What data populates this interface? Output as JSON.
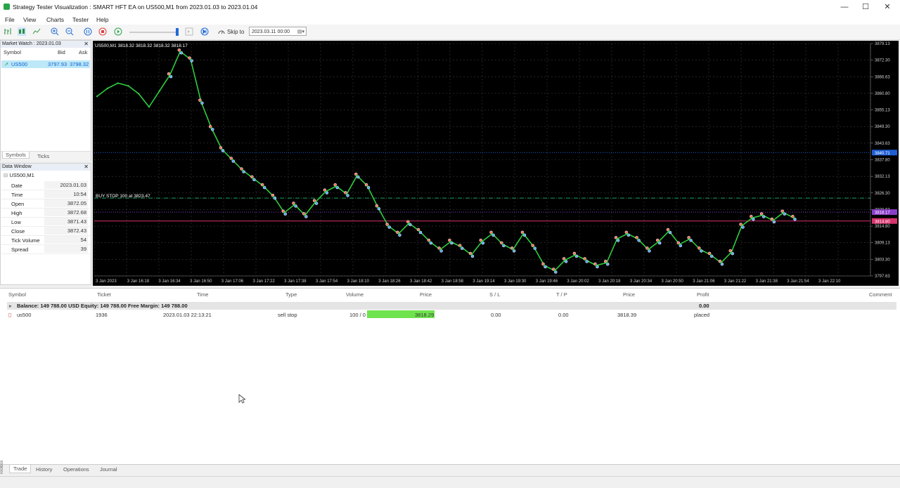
{
  "window": {
    "title": "Strategy Tester Visualization : SMART HFT EA  on US500,M1 from 2023.01.03 to 2023.01.04",
    "minimize": "—",
    "maximize": "☐",
    "close": "✕"
  },
  "menu": [
    "File",
    "View",
    "Charts",
    "Tester",
    "Help"
  ],
  "toolbar": {
    "skip_label": "Skip to",
    "skip_value": "2023.03.11 00:00"
  },
  "market_watch": {
    "title": "Market Watch : 2023.01.03",
    "columns": [
      "Symbol",
      "Bid",
      "Ask"
    ],
    "rows": [
      {
        "symbol": "US500",
        "bid": "3797.93",
        "ask": "3798.32"
      }
    ],
    "tabs": [
      "Symbols",
      "Ticks"
    ]
  },
  "data_window": {
    "title": "Data Window",
    "symbol": "US500,M1",
    "rows": [
      {
        "k": "Date",
        "v": "2023.01.03"
      },
      {
        "k": "Time",
        "v": "10:54"
      },
      {
        "k": "Open",
        "v": "3872.05"
      },
      {
        "k": "High",
        "v": "3872.68"
      },
      {
        "k": "Low",
        "v": "3871.43"
      },
      {
        "k": "Close",
        "v": "3872.43"
      },
      {
        "k": "Tick Volume",
        "v": "54"
      },
      {
        "k": "Spread",
        "v": "39"
      }
    ]
  },
  "chart_data": {
    "type": "line",
    "header": "US500,M1  3818.32  3818.32  3818.32  3818.17",
    "order_label": "BUY STOP 100 at 3823.47",
    "ylim": [
      3794,
      3882
    ],
    "y_ticks": [
      "3879.13",
      "3872.30",
      "3866.63",
      "3860.80",
      "3855.13",
      "3849.30",
      "3843.63",
      "3837.80",
      "3832.13",
      "3826.30",
      "3820.63",
      "3814.80",
      "3809.13",
      "3803.30",
      "3797.63"
    ],
    "y_tags": [
      {
        "label": "3840.71",
        "color": "#1f5fd6"
      },
      {
        "label": "3818.17",
        "color": "#8a3fc8"
      },
      {
        "label": "3814.80",
        "color": "#d6336c"
      }
    ],
    "x_ticks": [
      "3 Jan 2023",
      "3 Jan 16:18",
      "3 Jan 16:34",
      "3 Jan 16:50",
      "3 Jan 17:06",
      "3 Jan 17:22",
      "3 Jan 17:38",
      "3 Jan 17:54",
      "3 Jan 18:10",
      "3 Jan 18:26",
      "3 Jan 18:42",
      "3 Jan 18:58",
      "3 Jan 19:14",
      "3 Jan 19:30",
      "3 Jan 19:46",
      "3 Jan 20:02",
      "3 Jan 20:18",
      "3 Jan 20:34",
      "3 Jan 20:50",
      "3 Jan 21:06",
      "3 Jan 21:22",
      "3 Jan 21:38",
      "3 Jan 21:54",
      "3 Jan 22:10"
    ],
    "series": [
      {
        "values": [
          3862,
          3865,
          3867,
          3866,
          3863,
          3858,
          3864,
          3870,
          3879,
          3876,
          3860,
          3850,
          3842,
          3838,
          3834,
          3831,
          3828,
          3824,
          3818,
          3821,
          3817,
          3822,
          3826,
          3828,
          3825,
          3832,
          3828,
          3820,
          3813,
          3810,
          3814,
          3811,
          3807,
          3804,
          3807,
          3805,
          3802,
          3807,
          3810,
          3806,
          3804,
          3810,
          3805,
          3798,
          3796,
          3800,
          3802,
          3800,
          3798,
          3799,
          3808,
          3810,
          3808,
          3804,
          3807,
          3811,
          3806,
          3808,
          3804,
          3802,
          3799,
          3803,
          3813,
          3816,
          3817,
          3815,
          3818,
          3816
        ]
      }
    ],
    "levels": [
      {
        "value": 3840.71,
        "color": "#1f5fd6",
        "style": "dotted"
      },
      {
        "value": 3823.47,
        "color": "#1fa05a",
        "style": "dashdot"
      },
      {
        "value": 3818.17,
        "color": "#8a3fc8",
        "style": "dotted"
      },
      {
        "value": 3814.8,
        "color": "#d6336c",
        "style": "solid"
      }
    ]
  },
  "terminal": {
    "columns": [
      "Symbol",
      "Ticket",
      "Time",
      "Type",
      "Volume",
      "Price",
      "S / L",
      "T / P",
      "Price",
      "Profit",
      "Comment"
    ],
    "balance_text": "Balance: 149 788.00 USD  Equity: 149 788.00  Free Margin: 149 788.00",
    "balance_profit": "0.00",
    "orders": [
      {
        "symbol": "us500",
        "ticket": "1936",
        "time": "2023.01.03 22:13:21",
        "type": "sell stop",
        "volume": "100 / 0",
        "price": "3818.29",
        "sl": "0.00",
        "tp": "0.00",
        "cur_price": "3818.39",
        "profit": "placed"
      }
    ],
    "tabs": [
      "Trade",
      "History",
      "Operations",
      "Journal"
    ],
    "toolbox_label": "Toolbox"
  }
}
